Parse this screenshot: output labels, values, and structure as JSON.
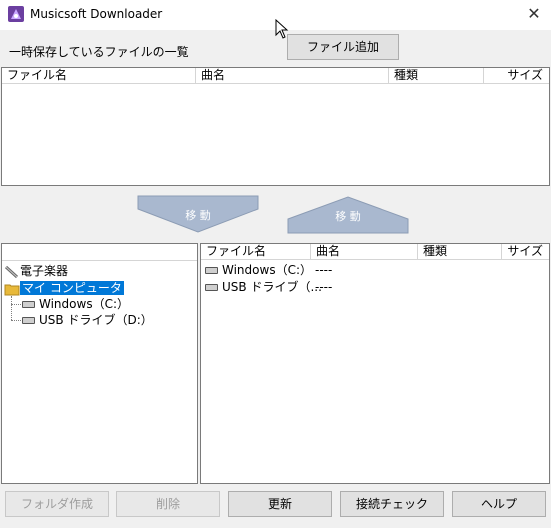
{
  "window": {
    "title": "Musicsoft Downloader",
    "close_glyph": "✕"
  },
  "top": {
    "label": "一時保存しているファイルの一覧",
    "add_file_button": "ファイル追加",
    "columns": [
      "ファイル名",
      "曲名",
      "種類",
      "サイズ"
    ]
  },
  "arrows": {
    "down_label": "移 動",
    "up_label": "移 動"
  },
  "tree": {
    "items": [
      {
        "label": "電子楽器"
      },
      {
        "label": "マイ コンピュータ"
      },
      {
        "label": "Windows（C:）"
      },
      {
        "label": "USB ドライブ（D:）"
      }
    ]
  },
  "bottom_list": {
    "columns": [
      "ファイル名",
      "曲名",
      "種類",
      "サイズ"
    ],
    "rows": [
      {
        "name": "Windows（C:）",
        "title": "----"
      },
      {
        "name": "USB ドライブ（...",
        "title": "----"
      }
    ]
  },
  "buttons": {
    "new_folder": "フォルダ作成",
    "delete": "削除",
    "refresh": "更新",
    "connection_check": "接続チェック",
    "help": "ヘルプ"
  }
}
